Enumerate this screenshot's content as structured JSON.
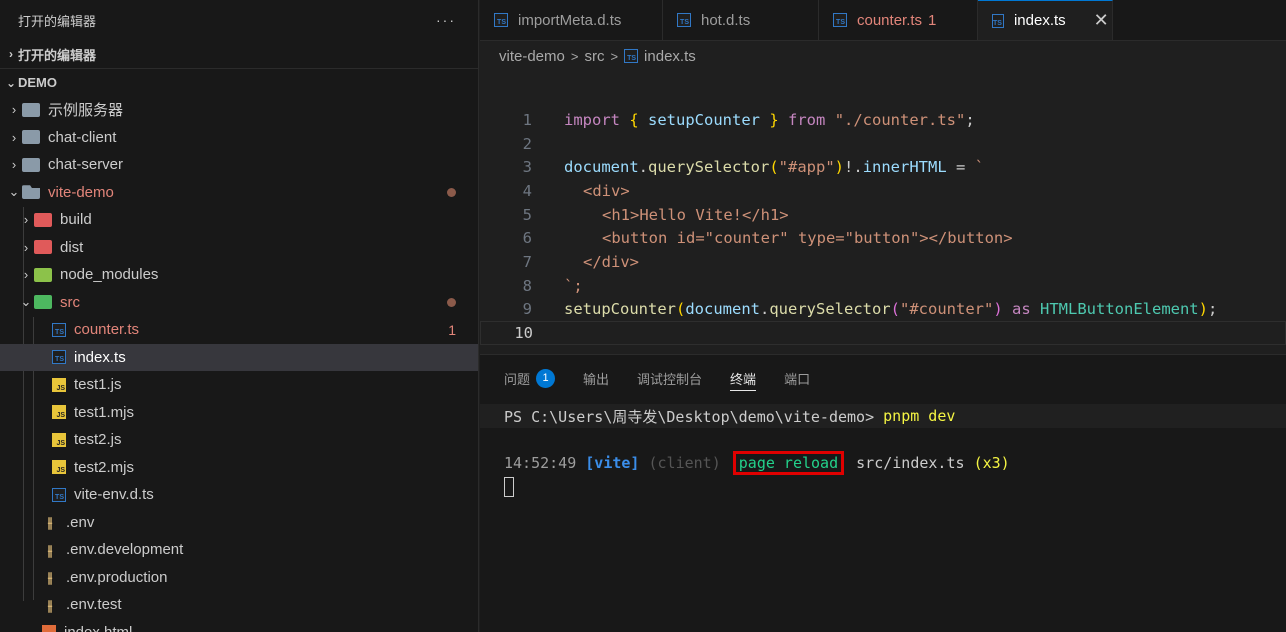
{
  "sidebar": {
    "header_title": "打开的编辑器",
    "more": "···",
    "open_editors_label": "打开的编辑器",
    "workspace_label": "DEMO",
    "items": [
      {
        "label": "示例服务器"
      },
      {
        "label": "chat-client"
      },
      {
        "label": "chat-server"
      },
      {
        "label": "vite-demo"
      },
      {
        "label": "build"
      },
      {
        "label": "dist"
      },
      {
        "label": "node_modules"
      },
      {
        "label": "src"
      },
      {
        "label": "counter.ts",
        "badge": "1"
      },
      {
        "label": "index.ts"
      },
      {
        "label": "test1.js"
      },
      {
        "label": "test1.mjs"
      },
      {
        "label": "test2.js"
      },
      {
        "label": "test2.mjs"
      },
      {
        "label": "vite-env.d.ts"
      },
      {
        "label": ".env"
      },
      {
        "label": ".env.development"
      },
      {
        "label": ".env.production"
      },
      {
        "label": ".env.test"
      },
      {
        "label": "index.html"
      }
    ]
  },
  "tabs": [
    {
      "label": "importMeta.d.ts"
    },
    {
      "label": "hot.d.ts"
    },
    {
      "label": "counter.ts",
      "count": "1"
    },
    {
      "label": "index.ts",
      "close": "✕"
    }
  ],
  "breadcrumb": {
    "p1": "vite-demo",
    "p2": "src",
    "p3": "index.ts",
    "sep": ">"
  },
  "code": {
    "line_numbers": [
      "1",
      "2",
      "3",
      "4",
      "5",
      "6",
      "7",
      "8",
      "9",
      "10"
    ],
    "l1": {
      "kw1": "import",
      "ob": "{",
      "id": " setupCounter ",
      "cb": "}",
      "kw2": " from ",
      "str": "\"./counter.ts\"",
      "end": ";"
    },
    "l3": {
      "obj": "document",
      "dot": ".",
      "fn": "querySelector",
      "p1": "(",
      "str": "\"#app\"",
      "p2": ")",
      "bang": "!.",
      "prop": "innerHTML",
      "eq": " = ",
      "tick": "`"
    },
    "l4": "<div>",
    "l5": "<h1>Hello Vite!</h1>",
    "l6": "<button id=\"counter\" type=\"button\"></button>",
    "l7": "</div>",
    "l8": "`;",
    "l9": {
      "fn": "setupCounter",
      "p1": "(",
      "obj": "document",
      "dot": ".",
      "fn2": "querySelector",
      "p2": "(",
      "str": "\"#counter\"",
      "p3": ")",
      "as": " as ",
      "typ": "HTMLButtonElement",
      "p4": ")",
      "end": ";"
    }
  },
  "panel": {
    "tabs": [
      {
        "label": "问题",
        "badge": "1"
      },
      {
        "label": "输出"
      },
      {
        "label": "调试控制台"
      },
      {
        "label": "终端"
      },
      {
        "label": "端口"
      }
    ],
    "prompt": "PS C:\\Users\\周寺发\\Desktop\\demo\\vite-demo> ",
    "command": "pnpm dev",
    "log": {
      "time": "14:52:49 ",
      "tag": "[vite]",
      "client": " (client) ",
      "action": "page reload",
      "file": " src/index.ts ",
      "count": "(x3)"
    }
  },
  "colors": {
    "accent": "#0078d4",
    "highlight_box": "#e00000",
    "error": "#e2857a"
  }
}
